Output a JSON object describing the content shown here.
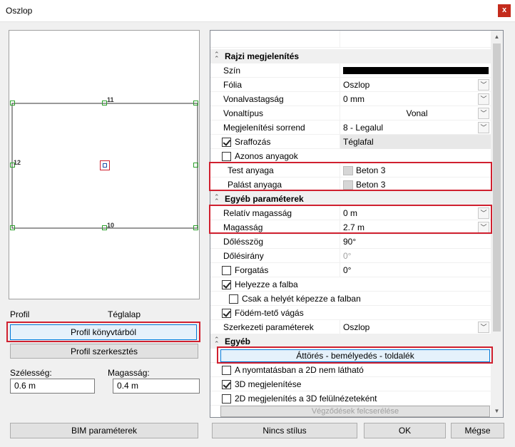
{
  "window": {
    "title": "Oszlop",
    "close": "x"
  },
  "preview": {
    "labels": {
      "top": "11",
      "left": "12",
      "bottom": "10"
    }
  },
  "profile": {
    "label": "Profil",
    "value": "Téglalap",
    "library_button": "Profil könyvtárból",
    "edit_button": "Profil szerkesztés",
    "width_label": "Szélesség:",
    "width_value": "0.6 m",
    "height_label": "Magasság:",
    "height_value": "0.4 m"
  },
  "sections": {
    "drawing": "Rajzi megjelenítés",
    "other_params": "Egyéb paraméterek",
    "other": "Egyéb"
  },
  "props": {
    "color": {
      "label": "Szín",
      "value": "#000000"
    },
    "layer": {
      "label": "Fólia",
      "value": "Oszlop"
    },
    "linewidth": {
      "label": "Vonalvastagság",
      "value": "0 mm"
    },
    "linetype": {
      "label": "Vonaltípus",
      "value": "Vonal"
    },
    "order": {
      "label": "Megjelenítési sorrend",
      "value": "8 - Legalul"
    },
    "hatch": {
      "label": "Sraffozás",
      "value": "Téglafal",
      "checked": true
    },
    "same_materials": {
      "label": "Azonos anyagok",
      "checked": false
    },
    "body_material": {
      "label": "Test anyaga",
      "value": "Beton 3"
    },
    "shell_material": {
      "label": "Palást anyaga",
      "value": "Beton 3"
    },
    "rel_height": {
      "label": "Relatív magasság",
      "value": "0 m"
    },
    "height": {
      "label": "Magasság",
      "value": "2.7 m"
    },
    "tilt_angle": {
      "label": "Dőlésszög",
      "value": "90°"
    },
    "tilt_dir": {
      "label": "Dőlésirány",
      "value": "0°"
    },
    "rotation": {
      "label": "Forgatás",
      "value": "0°",
      "checked": false
    },
    "place_in_wall": {
      "label": "Helyezze a falba",
      "checked": true
    },
    "hole_only": {
      "label": "Csak a helyét képezze a falban",
      "checked": false
    },
    "slab_cut": {
      "label": "Födém-tető vágás",
      "checked": true
    },
    "struct_params": {
      "label": "Szerkezeti paraméterek",
      "value": "Oszlop"
    },
    "openings_button": "Áttörés - bemélyedés - toldalék",
    "not_visible_2d": {
      "label": "A nyomtatásban a 2D nem látható",
      "checked": false
    },
    "show_3d": {
      "label": "3D megjelenítése",
      "checked": true
    },
    "as_3d_top": {
      "label": "2D megjelenítés a 3D felülnézeteként",
      "checked": false
    },
    "swap_endings_button": "Végződések felcserélése"
  },
  "footer": {
    "bim": "BIM paraméterek",
    "style": "Nincs stílus",
    "ok": "OK",
    "cancel": "Mégse"
  }
}
